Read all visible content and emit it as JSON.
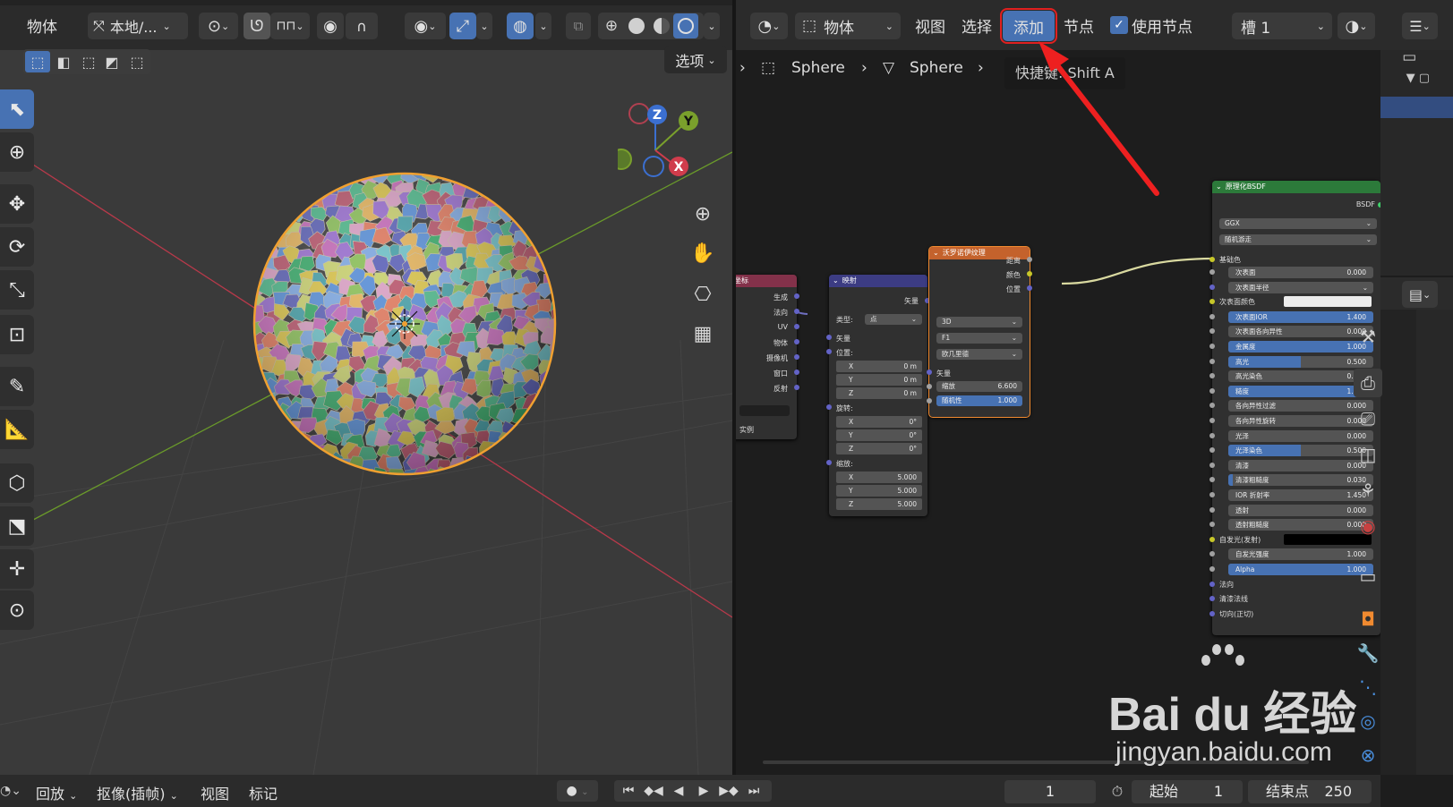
{
  "viewport_header": {
    "mode_label": "物体",
    "orientation_label": "本地/...",
    "options_label": "选项"
  },
  "node_header": {
    "object_label": "物体",
    "menu_view": "视图",
    "menu_select": "选择",
    "menu_add": "添加",
    "menu_node": "节点",
    "use_nodes_label": "使用节点",
    "use_nodes_checked": true,
    "slot_label": "槽 1"
  },
  "breadcrumb": {
    "items": [
      "Sphere",
      "Sphere"
    ],
    "tooltip": "快捷键: Shift A"
  },
  "gizmo": {
    "z": "Z",
    "y": "Y",
    "x": "X"
  },
  "nodes": {
    "texcoord": {
      "title": "坐标",
      "outputs": [
        "生成",
        "法向",
        "UV",
        "物体",
        "摄像机",
        "窗口",
        "反射"
      ],
      "footer": "实例"
    },
    "mapping": {
      "title": "映射",
      "output": "矢量",
      "type_label": "类型:",
      "type_value": "点",
      "vector_label": "矢量",
      "location_label": "位置:",
      "location": [
        [
          "X",
          "0 m"
        ],
        [
          "Y",
          "0 m"
        ],
        [
          "Z",
          "0 m"
        ]
      ],
      "rotation_label": "旋转:",
      "rotation": [
        [
          "X",
          "0°"
        ],
        [
          "Y",
          "0°"
        ],
        [
          "Z",
          "0°"
        ]
      ],
      "scale_label": "缩放:",
      "scale": [
        [
          "X",
          "5.000"
        ],
        [
          "Y",
          "5.000"
        ],
        [
          "Z",
          "5.000"
        ]
      ]
    },
    "voronoi": {
      "title": "沃罗诺伊纹理",
      "outputs": [
        "距离",
        "颜色",
        "位置"
      ],
      "dims": "3D",
      "feature": "F1",
      "metric": "欧几里德",
      "vector_label": "矢量",
      "scale_label": "缩放",
      "scale_value": "6.600",
      "random_label": "随机性",
      "random_value": "1.000",
      "random_fraction": 1.0
    },
    "bsdf": {
      "title": "原理化BSDF",
      "output": "BSDF",
      "distribution": "GGX",
      "subsurface_method": "随机游走",
      "base_color_label": "基础色",
      "rows": [
        {
          "label": "次表面",
          "value": "0.000",
          "fill": 0,
          "socket": "#a1a1a1"
        },
        {
          "label": "次表面半径",
          "value": "",
          "fill": 0,
          "dropdown": true,
          "socket": "#6363c7"
        },
        {
          "label": "次表面颜色",
          "value": "",
          "fill": 0,
          "color": "#ececec",
          "socket": "#c7c729"
        },
        {
          "label": "次表面IOR",
          "value": "1.400",
          "fill": 1,
          "socket": "#a1a1a1"
        },
        {
          "label": "次表面各向异性",
          "value": "0.000",
          "fill": 0,
          "socket": "#a1a1a1"
        },
        {
          "label": "金属度",
          "value": "1.000",
          "fill": 1,
          "socket": "#a1a1a1"
        },
        {
          "label": "高光",
          "value": "0.500",
          "fill": 0.5,
          "socket": "#a1a1a1"
        },
        {
          "label": "高光染色",
          "value": "0.000",
          "fill": 0,
          "socket": "#a1a1a1"
        },
        {
          "label": "糙度",
          "value": "1.000",
          "fill": 1,
          "socket": "#a1a1a1"
        },
        {
          "label": "各向异性过滤",
          "value": "0.000",
          "fill": 0,
          "socket": "#a1a1a1"
        },
        {
          "label": "各向异性旋转",
          "value": "0.000",
          "fill": 0,
          "socket": "#a1a1a1"
        },
        {
          "label": "光泽",
          "value": "0.000",
          "fill": 0,
          "socket": "#a1a1a1"
        },
        {
          "label": "光泽染色",
          "value": "0.500",
          "fill": 0.5,
          "socket": "#a1a1a1"
        },
        {
          "label": "清漆",
          "value": "0.000",
          "fill": 0,
          "socket": "#a1a1a1"
        },
        {
          "label": "清漆粗糙度",
          "value": "0.030",
          "fill": 0.03,
          "socket": "#a1a1a1"
        },
        {
          "label": "IOR 折射率",
          "value": "1.450",
          "fill": 0,
          "socket": "#a1a1a1"
        },
        {
          "label": "透射",
          "value": "0.000",
          "fill": 0,
          "socket": "#a1a1a1"
        },
        {
          "label": "透射粗糙度",
          "value": "0.000",
          "fill": 0,
          "socket": "#a1a1a1"
        },
        {
          "label": "自发光(发射)",
          "value": "",
          "fill": 0,
          "color": "#000000",
          "socket": "#c7c729"
        },
        {
          "label": "自发光强度",
          "value": "1.000",
          "fill": 0,
          "socket": "#a1a1a1"
        },
        {
          "label": "Alpha",
          "value": "1.000",
          "fill": 1,
          "socket": "#a1a1a1"
        },
        {
          "label": "法向",
          "value": "",
          "fill": 0,
          "plain": true,
          "socket": "#6363c7"
        },
        {
          "label": "清漆法线",
          "value": "",
          "fill": 0,
          "plain": true,
          "socket": "#6363c7"
        },
        {
          "label": "切向(正切)",
          "value": "",
          "fill": 0,
          "plain": true,
          "socket": "#6363c7"
        }
      ]
    }
  },
  "timeline": {
    "playback": "回放",
    "keying": "抠像(插帧)",
    "view": "视图",
    "marker": "标记",
    "current_frame": "1",
    "start_label": "起始",
    "start_value": "1",
    "end_label": "结束点",
    "end_value": "250"
  },
  "watermark": {
    "brand": "Bai du 经验",
    "url": "jingyan.baidu.com"
  },
  "colors": {
    "accent": "#4772b3",
    "highlight": "#e02020",
    "texcoord_header": "#83314a",
    "mapping_header": "#3c3c83",
    "voronoi_header": "#c4622c",
    "bsdf_header": "#2c7a3a"
  },
  "icons": [
    "select-box-icon",
    "cursor-icon",
    "move-icon",
    "rotate-icon",
    "scale-icon",
    "transform-icon",
    "annotate-icon",
    "measure-icon",
    "add-cube-icon",
    "zoom-icon",
    "hand-icon",
    "camera-icon",
    "grid-icon",
    "wrench-icon",
    "render-icon",
    "output-icon",
    "view-layer-icon",
    "scene-icon",
    "world-icon",
    "collection-icon",
    "object-icon",
    "modifier-icon",
    "particles-icon",
    "physics-icon",
    "constraints-icon",
    "data-icon"
  ]
}
